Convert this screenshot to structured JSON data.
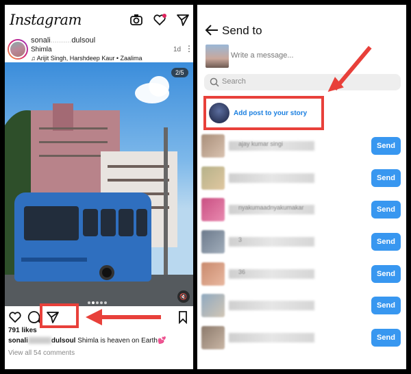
{
  "left": {
    "header": {
      "logo": "Instagram"
    },
    "post": {
      "username": "sonali",
      "username_rest": "dulsoul",
      "location": "Shimla",
      "music": "Arijit Singh, Harshdeep Kaur • Zaalima",
      "time": "1d",
      "photo_index": "2/5",
      "likes": "791 likes",
      "caption_user": "sonali",
      "caption_user_rest": "dulsoul",
      "caption_text": " Shimla is heaven on Earth💕",
      "comments_link": "View all 54 comments"
    }
  },
  "right": {
    "title": "Send to",
    "message_placeholder": "Write a message...",
    "search_placeholder": "Search",
    "story_label": "Add post to your story",
    "send_label": "Send",
    "contacts": [
      {
        "partial_name": "ajay kumar singi",
        "colors": [
          "#a98f7a",
          "#d9c2b0"
        ]
      },
      {
        "partial_name": "",
        "colors": [
          "#b6b28a",
          "#e0c7a0"
        ]
      },
      {
        "partial_name": "nyakumaadnyakumakar",
        "colors": [
          "#c94f82",
          "#e98ab0"
        ]
      },
      {
        "partial_name": "3",
        "colors": [
          "#6c7a8c",
          "#a2aebb"
        ]
      },
      {
        "partial_name": "36",
        "colors": [
          "#c98a6d",
          "#e9b8a0"
        ]
      },
      {
        "partial_name": "",
        "colors": [
          "#8fa9c0",
          "#d2c6b5"
        ]
      },
      {
        "partial_name": "",
        "colors": [
          "#8c7a6c",
          "#c9b6a5"
        ]
      }
    ]
  },
  "colors": {
    "accent_red": "#e8403a",
    "send_blue": "#3897f0",
    "story_blue": "#1a7fe0"
  }
}
